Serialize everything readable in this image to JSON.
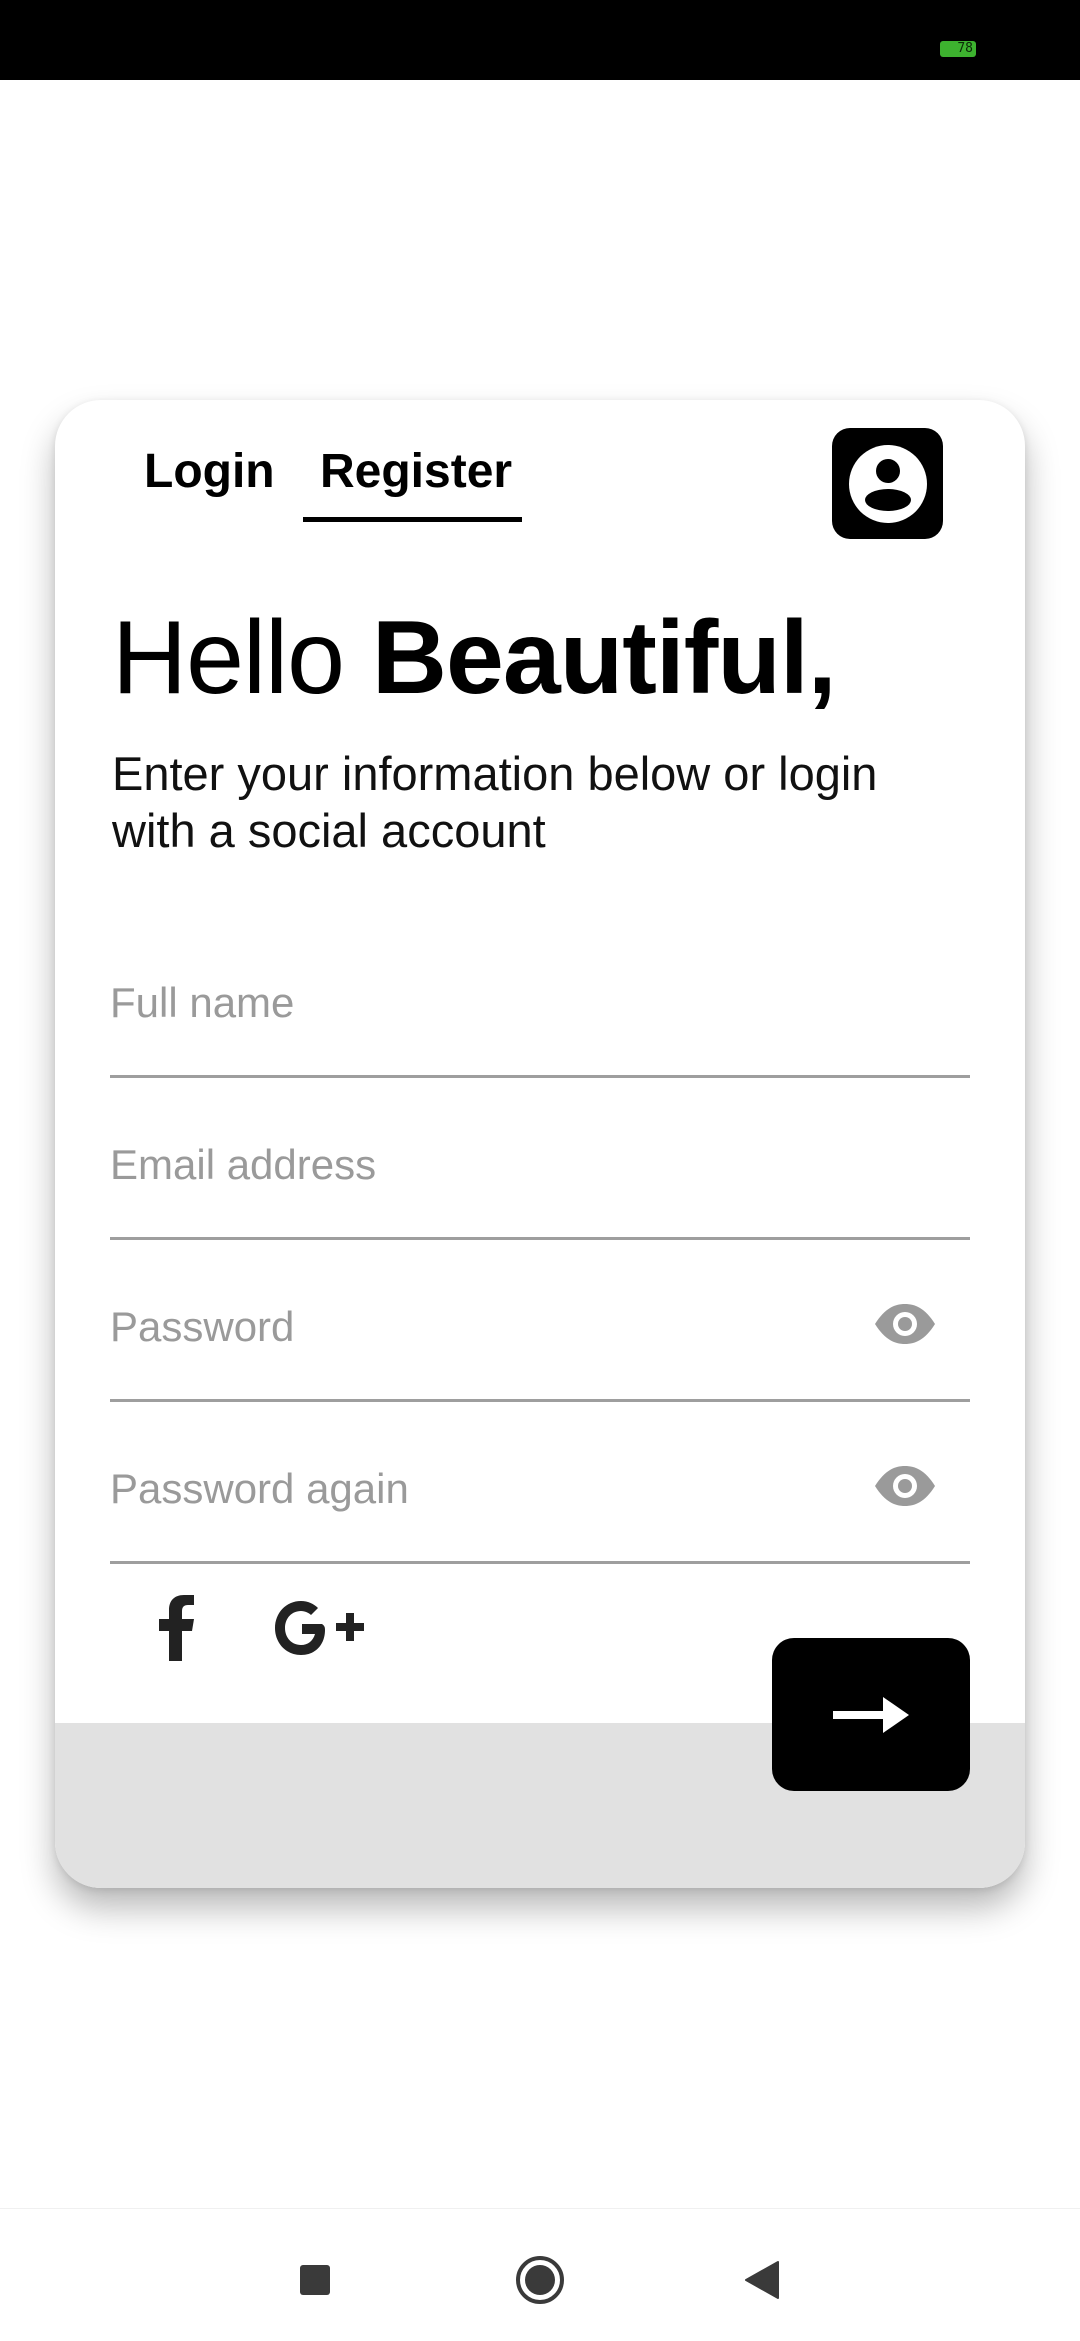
{
  "status_bar": {
    "battery_level": "78"
  },
  "tabs": [
    {
      "label": "Login",
      "selected": false
    },
    {
      "label": "Register",
      "selected": true
    }
  ],
  "greeting": {
    "regular": "Hello",
    "bold": "Beautiful,"
  },
  "subtitle": "Enter your information below or login with a social account",
  "form": {
    "fullname_placeholder": "Full name",
    "email_placeholder": "Email address",
    "password_placeholder": "Password",
    "password_again_placeholder": "Password again"
  },
  "icons": {
    "profile": "account-circle-icon",
    "visibility": "eye-icon",
    "facebook": "facebook-icon",
    "google_plus": "google-plus-icon",
    "submit": "arrow-right-icon",
    "nav_recents": "square-icon",
    "nav_home": "circle-icon",
    "nav_back": "triangle-back-icon"
  },
  "colors": {
    "primary": "#000000",
    "background": "#ffffff",
    "card_footer": "#e1e1e1",
    "placeholder": "#9a9a9a",
    "battery": "#3db22f"
  }
}
